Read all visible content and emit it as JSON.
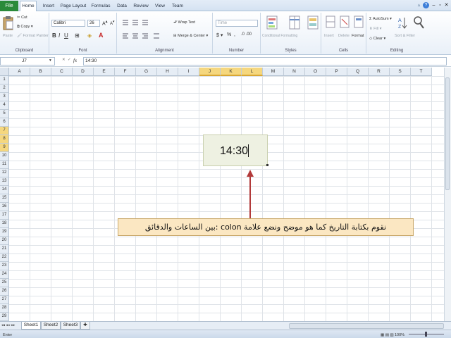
{
  "ribbon_tabs": [
    "File",
    "Home",
    "Insert",
    "Page Layout",
    "Formulas",
    "Data",
    "Review",
    "View",
    "Team"
  ],
  "clipboard": {
    "paste": "Paste",
    "cut": "Cut",
    "copy": "Copy",
    "format_painter": "Format Painter",
    "label": "Clipboard"
  },
  "font": {
    "name": "Calibri",
    "size": "26",
    "label": "Font"
  },
  "alignment": {
    "wrap_text": "Wrap Text",
    "merge_center": "Merge & Center",
    "label": "Alignment"
  },
  "number": {
    "format": "Time",
    "label": "Number"
  },
  "styles": {
    "conditional": "Conditional Formatting",
    "format_table": "Format as Table",
    "cell_styles": "Cell Styles",
    "label": "Styles"
  },
  "cells": {
    "insert": "Insert",
    "delete": "Delete",
    "format": "Format",
    "label": "Cells"
  },
  "editing": {
    "autosum": "AutoSum",
    "fill": "Fill",
    "clear": "Clear",
    "sort_filter": "Sort & Filter",
    "find_select": "Find & Select",
    "label": "Editing"
  },
  "formula_bar": {
    "name_box": "J7",
    "fx": "fx",
    "content": "14:30"
  },
  "columns": [
    "A",
    "B",
    "C",
    "D",
    "E",
    "F",
    "G",
    "H",
    "I",
    "J",
    "K",
    "L",
    "M",
    "N",
    "O",
    "P",
    "Q",
    "R",
    "S",
    "T"
  ],
  "rows": [
    "1",
    "2",
    "3",
    "4",
    "5",
    "6",
    "7",
    "8",
    "9",
    "10",
    "11",
    "12",
    "13",
    "14",
    "15",
    "16",
    "17",
    "18",
    "19",
    "20",
    "21",
    "22",
    "23",
    "24",
    "25",
    "26",
    "27",
    "28",
    "29"
  ],
  "cell_value": "14:30",
  "callout_text": "نقوم بكتابة التاريخ كما هو موضح ونضع علامة colon :بين الساعات والدقائق",
  "sheet_tabs": [
    "Sheet1",
    "Sheet2",
    "Sheet3"
  ],
  "status": {
    "mode": "Enter",
    "zoom": "100%"
  },
  "colors": {
    "accent": "#2a8a3a",
    "selected_header": "#f5d77e",
    "callout_bg": "#fbe7c2",
    "arrow": "#b23a3a"
  }
}
